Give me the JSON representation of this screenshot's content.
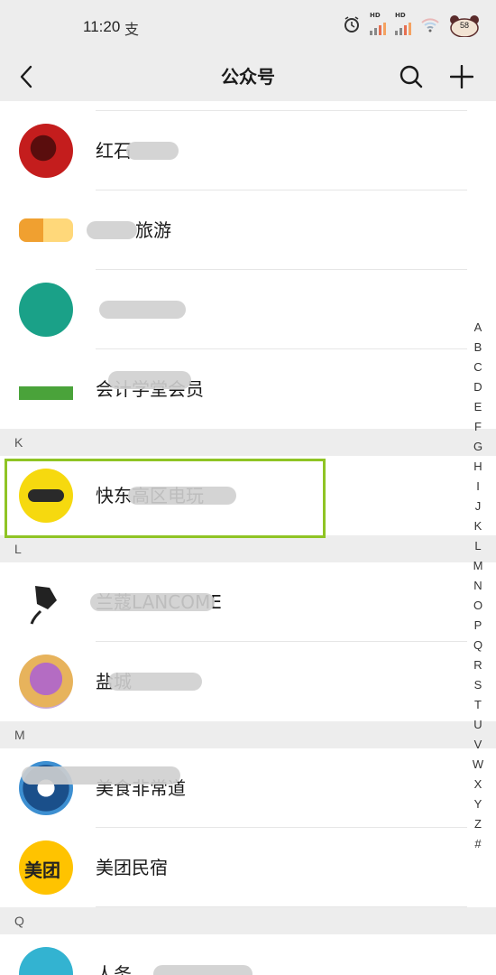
{
  "status": {
    "time": "11:20",
    "pay_icon": "alipay-icon",
    "battery": "58",
    "net_label": "HD"
  },
  "header": {
    "title": "公众号",
    "back_icon": "back-arrow-icon",
    "search_icon": "search-icon",
    "add_icon": "plus-icon"
  },
  "colors": {
    "bar_bg": "#ededed",
    "highlight": "#8fc425",
    "separator": "#e6e6e6"
  },
  "accounts_top": [
    {
      "name": "红石"
    },
    {
      "name": "旅游"
    },
    {
      "name": ""
    },
    {
      "name": "会计学堂会员"
    }
  ],
  "sections": [
    {
      "letter": "K",
      "items": [
        {
          "name": "快东高区电玩"
        }
      ]
    },
    {
      "letter": "L",
      "items": [
        {
          "name": "兰蔻LANCOME"
        },
        {
          "name": "盐城"
        }
      ]
    },
    {
      "letter": "M",
      "items": [
        {
          "name": "美食非常道"
        },
        {
          "name": "美团民宿"
        }
      ]
    },
    {
      "letter": "Q",
      "items": [
        {
          "name": "人务"
        }
      ]
    }
  ],
  "index_letters": [
    "A",
    "B",
    "C",
    "D",
    "E",
    "F",
    "G",
    "H",
    "I",
    "J",
    "K",
    "L",
    "M",
    "N",
    "O",
    "P",
    "Q",
    "R",
    "S",
    "T",
    "U",
    "V",
    "W",
    "X",
    "Y",
    "Z",
    "#"
  ]
}
